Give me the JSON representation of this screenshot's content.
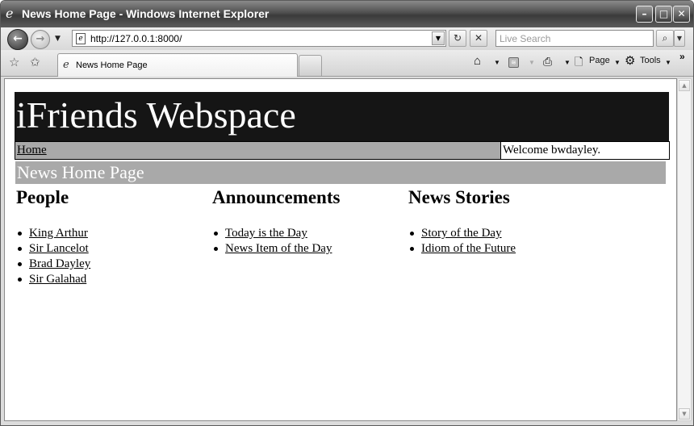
{
  "window": {
    "title": "News Home Page - Windows Internet Explorer",
    "min_glyph": "–",
    "max_glyph": "□",
    "close_glyph": "✕"
  },
  "toolbar": {
    "address": "http://127.0.0.1:8000/",
    "search_placeholder": "Live Search",
    "refresh_glyph": "↻",
    "stop_glyph": "✕",
    "search_glyph": "⌕"
  },
  "tabs": [
    {
      "label": "News Home Page",
      "active": true
    }
  ],
  "command_bar": {
    "page_label": "Page",
    "tools_label": "Tools"
  },
  "site": {
    "title": "iFriends Webspace",
    "nav_home": "Home",
    "welcome": "Welcome bwdayley.",
    "page_heading": "News Home Page"
  },
  "columns": [
    {
      "heading": "People",
      "links": [
        "King Arthur",
        "Sir Lancelot",
        "Brad Dayley",
        "Sir Galahad"
      ]
    },
    {
      "heading": "Announcements",
      "links": [
        "Today is the Day",
        "News Item of the Day"
      ]
    },
    {
      "heading": "News Stories",
      "links": [
        "Story of the Day",
        "Idiom of the Future"
      ]
    }
  ],
  "colors": {
    "header_bg": "#151515",
    "nav_bg": "#a9a9a9",
    "page_heading_bg": "#a9a9a9"
  }
}
